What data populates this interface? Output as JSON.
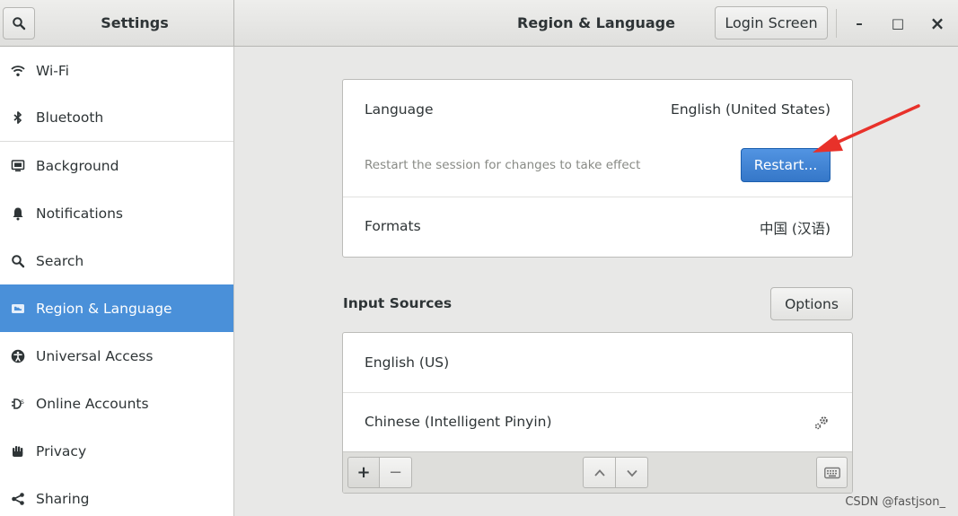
{
  "header": {
    "left_title": "Settings",
    "title": "Region & Language",
    "login_screen_label": "Login Screen",
    "minimize_glyph": "–",
    "maximize_glyph": "□",
    "close_glyph": "×"
  },
  "sidebar": {
    "items": [
      {
        "label": "Wi-Fi",
        "icon": "wifi-icon"
      },
      {
        "label": "Bluetooth",
        "icon": "bluetooth-icon"
      },
      {
        "label": "Background",
        "icon": "background-icon"
      },
      {
        "label": "Notifications",
        "icon": "bell-icon"
      },
      {
        "label": "Search",
        "icon": "search-icon"
      },
      {
        "label": "Region & Language",
        "icon": "region-icon",
        "selected": true
      },
      {
        "label": "Universal Access",
        "icon": "accessibility-icon"
      },
      {
        "label": "Online Accounts",
        "icon": "online-accounts-icon"
      },
      {
        "label": "Privacy",
        "icon": "hand-icon"
      },
      {
        "label": "Sharing",
        "icon": "share-icon"
      }
    ]
  },
  "language_section": {
    "language_label": "Language",
    "language_value": "English (United States)",
    "restart_message": "Restart the session for changes to take effect",
    "restart_button": "Restart...",
    "formats_label": "Formats",
    "formats_value": "中国 (汉语)"
  },
  "input_sources": {
    "title": "Input Sources",
    "options_button": "Options",
    "sources": [
      {
        "label": "English (US)"
      },
      {
        "label": "Chinese (Intelligent Pinyin)",
        "has_settings": true
      }
    ],
    "toolbar": {
      "add": "+",
      "remove": "−"
    }
  },
  "watermark": "CSDN @fastjson_",
  "colors": {
    "accent": "#4a90d9",
    "annotation_arrow": "#e8312a"
  }
}
